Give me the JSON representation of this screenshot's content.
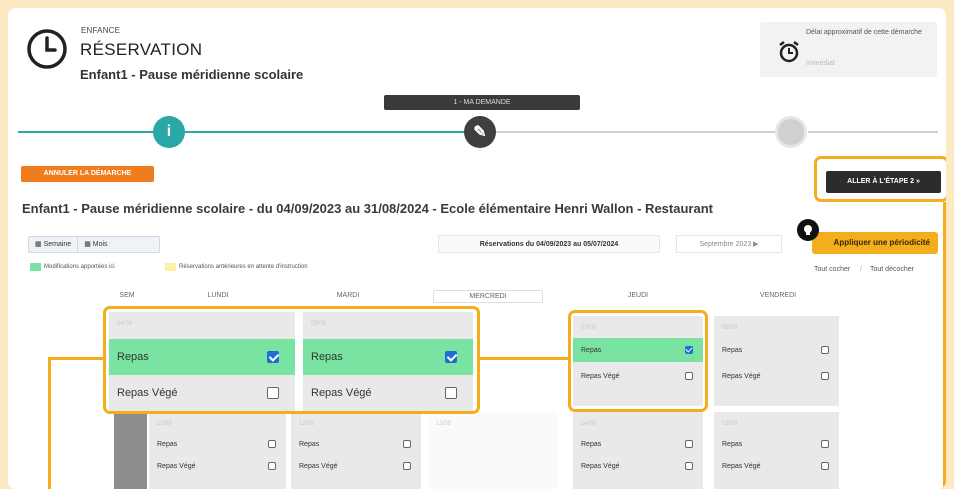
{
  "header": {
    "category": "ENFANCE",
    "title": "RÉSERVATION",
    "subtitle": "Enfant1 - Pause méridienne scolaire",
    "delay_text": "Délai approximatif de cette démarche",
    "delay_value": "Immédiat",
    "clock_icon": "clock-icon",
    "alarm_icon": "alarm-clock-icon"
  },
  "stepper": {
    "label": "1 - MA DEMANDE",
    "steps": [
      {
        "icon": "info-icon",
        "glyph": "i",
        "color": "#2aa8a8"
      },
      {
        "icon": "pencil-icon",
        "glyph": "✎",
        "color": "#3f3f3f"
      },
      {
        "icon": "circle-icon",
        "glyph": "",
        "color": "#d0d0d0"
      }
    ]
  },
  "buttons": {
    "cancel": "ANNULER LA DÉMARCHE",
    "next": "ALLER À L'ÉTAPE 2 »",
    "apply_period": "Appliquer une périodicité"
  },
  "heading": "Enfant1 - Pause méridienne scolaire - du 04/09/2023 au 31/08/2024 - Ecole élémentaire Henri Wallon - Restaurant",
  "toolbar": {
    "week": "Semaine",
    "month": "Mois",
    "reservations": "Réservations du 04/09/2023 au 05/07/2024",
    "month_nav": "Septembre 2023 ▶"
  },
  "legend": {
    "modified": "Modifications apportées ici",
    "pending": "Réservations antérieures en attente d'instruction",
    "modified_color": "#79e4a1",
    "pending_color": "#fbf0a8"
  },
  "select": {
    "check_all": "Tout cocher",
    "uncheck_all": "Tout décocher",
    "separator": "/"
  },
  "columns": [
    "SEM",
    "LUNDI",
    "MARDI",
    "MERCREDI",
    "JEUDI",
    "VENDREDI"
  ],
  "week1": {
    "monday": {
      "date": "04/09",
      "meals": [
        {
          "label": "Repas",
          "checked": true
        },
        {
          "label": "Repas Végé",
          "checked": false
        }
      ]
    },
    "tuesday": {
      "date": "05/09",
      "meals": [
        {
          "label": "Repas",
          "checked": true
        },
        {
          "label": "Repas Végé",
          "checked": false
        }
      ]
    },
    "thursday": {
      "date": "07/09",
      "meals": [
        {
          "label": "Repas",
          "checked": true
        },
        {
          "label": "Repas Végé",
          "checked": false
        }
      ]
    },
    "friday": {
      "date": "08/09",
      "meals": [
        {
          "label": "Repas",
          "checked": false
        },
        {
          "label": "Repas Végé",
          "checked": false
        }
      ]
    }
  },
  "week2": {
    "monday": {
      "date": "11/09",
      "meals": [
        {
          "label": "Repas",
          "checked": false
        },
        {
          "label": "Repas Végé",
          "checked": false
        }
      ]
    },
    "tuesday": {
      "date": "12/09",
      "meals": [
        {
          "label": "Repas",
          "checked": false
        },
        {
          "label": "Repas Végé",
          "checked": false
        }
      ]
    },
    "wednesday": {
      "date": "13/09"
    },
    "thursday": {
      "date": "14/09",
      "meals": [
        {
          "label": "Repas",
          "checked": false
        },
        {
          "label": "Repas Végé",
          "checked": false
        }
      ]
    },
    "friday": {
      "date": "15/09",
      "meals": [
        {
          "label": "Repas",
          "checked": false
        },
        {
          "label": "Repas Végé",
          "checked": false
        }
      ]
    }
  },
  "colors": {
    "highlight": "#f4ad1d",
    "accent": "#f07c1e",
    "selected": "#79e4a1",
    "background": "#fde9c4"
  }
}
